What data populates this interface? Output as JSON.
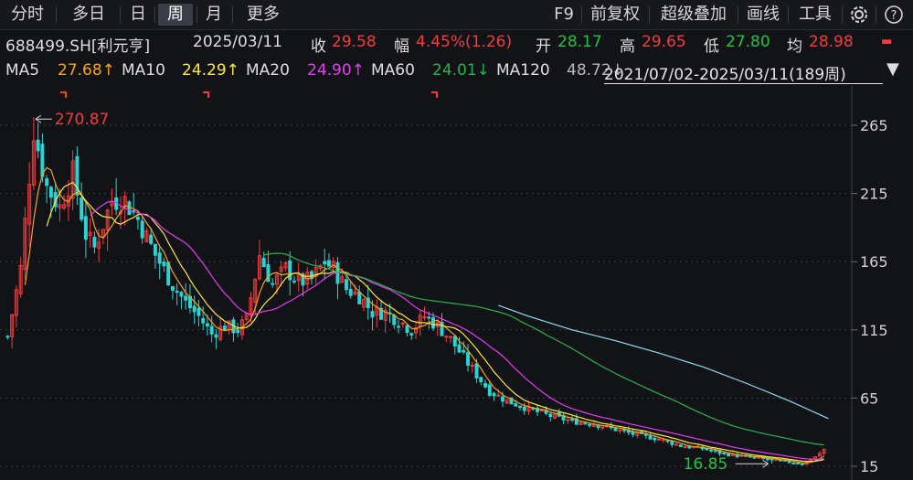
{
  "toolbar": {
    "tabs": [
      "分时",
      "多日",
      "日",
      "周",
      "月",
      "更多"
    ],
    "active_tab": "周",
    "right_items": [
      "F9",
      "前复权",
      "超级叠加",
      "画线",
      "工具"
    ],
    "gear_icon": "gear-icon",
    "help_icon": "question-circle-icon"
  },
  "info": {
    "code": "688499.SH[利元亨]",
    "date": "2025/03/11",
    "close_label": "收",
    "close": "29.58",
    "amp_label": "幅",
    "amp": "4.45%(1.26)",
    "open_label": "开",
    "open": "28.17",
    "high_label": "高",
    "high": "29.65",
    "low_label": "低",
    "low": "27.80",
    "avg_label": "均",
    "avg": "28.98"
  },
  "ma": {
    "ma5_label": "MA5",
    "ma5": "27.68↑",
    "ma10_label": "MA10",
    "ma10": "24.29↑",
    "ma20_label": "MA20",
    "ma20": "24.90↑",
    "ma60_label": "MA60",
    "ma60": "24.01↓",
    "ma120_label": "MA120",
    "ma120": "48.72↓",
    "range": "2021/07/02-2025/03/11(189周)",
    "collapse_icon": "triangle-down-icon"
  },
  "colors": {
    "up": "#f23d3d",
    "down": "#2bd3d3",
    "ma5": "#f7a21b",
    "ma10": "#ffe83d",
    "ma20": "#e43cf0",
    "ma60": "#27b34a",
    "ma120": "#8fdcf5"
  },
  "chart_data": {
    "type": "candlestick",
    "period": "weekly",
    "bars": 189,
    "y_ticks": [
      265,
      215,
      165,
      115,
      65,
      15
    ],
    "ylim": [
      0,
      290
    ],
    "max_label": "270.87",
    "min_label": "16.85",
    "anchors": [
      [
        0,
        110
      ],
      [
        3,
        160
      ],
      [
        6,
        262
      ],
      [
        9,
        220
      ],
      [
        12,
        205
      ],
      [
        15,
        230
      ],
      [
        18,
        185
      ],
      [
        20,
        175
      ],
      [
        24,
        210
      ],
      [
        27,
        210
      ],
      [
        30,
        196
      ],
      [
        34,
        170
      ],
      [
        38,
        148
      ],
      [
        41,
        135
      ],
      [
        44,
        125
      ],
      [
        47,
        112
      ],
      [
        50,
        118
      ],
      [
        53,
        115
      ],
      [
        55,
        123
      ],
      [
        58,
        170
      ],
      [
        61,
        148
      ],
      [
        64,
        160
      ],
      [
        67,
        150
      ],
      [
        70,
        152
      ],
      [
        73,
        165
      ],
      [
        75,
        160
      ],
      [
        78,
        145
      ],
      [
        81,
        140
      ],
      [
        84,
        128
      ],
      [
        87,
        128
      ],
      [
        90,
        122
      ],
      [
        93,
        115
      ],
      [
        96,
        125
      ],
      [
        99,
        118
      ],
      [
        102,
        108
      ],
      [
        105,
        95
      ],
      [
        108,
        82
      ],
      [
        111,
        70
      ],
      [
        115,
        63
      ],
      [
        120,
        57
      ],
      [
        125,
        52
      ],
      [
        130,
        48
      ],
      [
        135,
        46
      ],
      [
        140,
        42
      ],
      [
        145,
        38
      ],
      [
        150,
        35
      ],
      [
        155,
        30
      ],
      [
        160,
        28
      ],
      [
        165,
        24
      ],
      [
        170,
        22
      ],
      [
        175,
        20
      ],
      [
        180,
        18
      ],
      [
        183,
        17
      ],
      [
        186,
        22
      ],
      [
        189,
        29.6
      ]
    ],
    "ma120_anchors": [
      [
        113,
        133
      ],
      [
        120,
        125
      ],
      [
        130,
        115
      ],
      [
        140,
        107
      ],
      [
        150,
        98
      ],
      [
        160,
        88
      ],
      [
        170,
        76
      ],
      [
        180,
        63
      ],
      [
        189,
        50
      ]
    ]
  }
}
